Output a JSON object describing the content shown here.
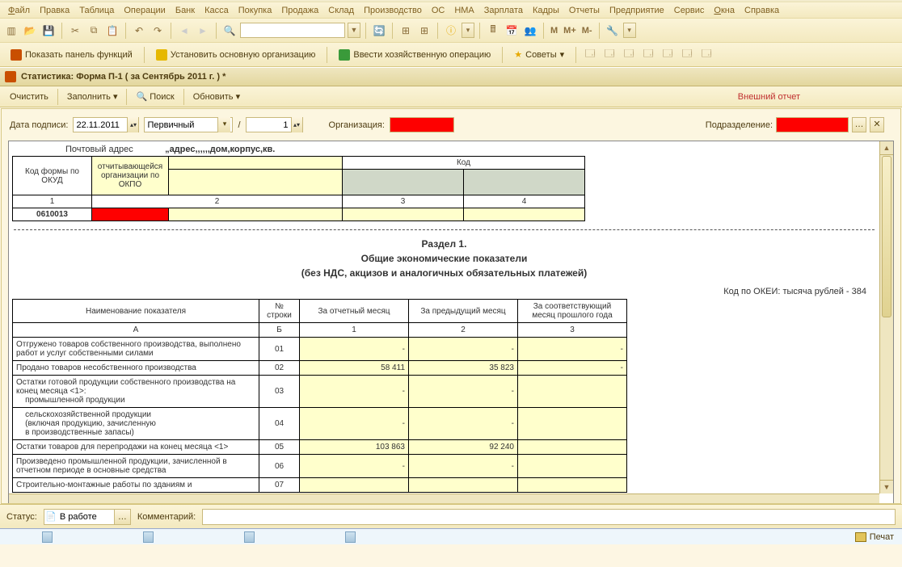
{
  "menu": {
    "file": "Файл",
    "edit": "Правка",
    "table": "Таблица",
    "ops": "Операции",
    "bank": "Банк",
    "kassa": "Касса",
    "buy": "Покупка",
    "sell": "Продажа",
    "sklad": "Склад",
    "proizv": "Производство",
    "os": "ОС",
    "nma": "НМА",
    "zp": "Зарплата",
    "kadry": "Кадры",
    "otchety": "Отчеты",
    "predpr": "Предприятие",
    "service": "Сервис",
    "okna": "Окна",
    "spr": "Справка"
  },
  "toolbar2": {
    "panel": "Показать панель функций",
    "org": "Установить основную организацию",
    "hoz": "Ввести хозяйственную операцию",
    "sov": "Советы"
  },
  "doctitle": "Статистика: Форма П-1 ( за Сентябрь 2011 г. ) *",
  "cmd": {
    "clear": "Очистить",
    "fill": "Заполнить",
    "find": "Поиск",
    "upd": "Обновить",
    "ext": "Внешний отчет"
  },
  "filters": {
    "date_lbl": "Дата подписи:",
    "date_val": "22.11.2011",
    "type_val": "Первичный",
    "num_lbl": "/",
    "num_val": "1",
    "org_lbl": "Организация:",
    "sub_lbl": "Подразделение:"
  },
  "addr": {
    "label": "Почтовый адрес",
    "val": "„адрес,,,,,,дом,корпус,кв."
  },
  "hdrtbl": {
    "kodformy": "Код формы по ОКУД",
    "otch": "отчитывающейся организации по ОКПО",
    "kod": "Код",
    "n1": "1",
    "n2": "2",
    "n3": "3",
    "n4": "4",
    "okud": "0610013"
  },
  "section": {
    "l1": "Раздел 1.",
    "l2": "Общие экономические показатели",
    "l3": "(без НДС, акцизов и аналогичных обязательных платежей)"
  },
  "okei": "Код по ОКЕИ: тысяча рублей - 384",
  "cols": {
    "name": "Наименование показателя",
    "num": "№ строки",
    "c1": "За отчетный месяц",
    "c2": "За предыдущий месяц",
    "c3": "За соответствующий месяц прошлого года",
    "hA": "А",
    "hB": "Б",
    "h1": "1",
    "h2": "2",
    "h3": "3"
  },
  "rows": [
    {
      "name": "Отгружено товаров собственного производства, выполнено работ и услуг собственными силами",
      "num": "01",
      "v1": "-",
      "v2": "-",
      "v3": "-"
    },
    {
      "name": "Продано товаров несобственного производства",
      "num": "02",
      "v1": "58 411",
      "v2": "35 823",
      "v3": "-"
    },
    {
      "name": "Остатки готовой продукции собственного производства на конец месяца <1>:\n    промышленной продукции",
      "num": "03",
      "v1": "-",
      "v2": "-",
      "v3": ""
    },
    {
      "name": "    сельскохозяйственной продукции\n    (включая продукцию, зачисленную\n    в производственные запасы)",
      "num": "04",
      "v1": "-",
      "v2": "-",
      "v3": ""
    },
    {
      "name": "Остатки товаров для перепродажи на конец месяца <1>",
      "num": "05",
      "v1": "103 863",
      "v2": "92 240",
      "v3": ""
    },
    {
      "name": "Произведено промышленной продукции, зачисленной в отчетном периоде в основные средства",
      "num": "06",
      "v1": "-",
      "v2": "-",
      "v3": ""
    },
    {
      "name": "Строительно-монтажные работы по зданиям и",
      "num": "07",
      "v1": "",
      "v2": "",
      "v3": ""
    }
  ],
  "status": {
    "lbl": "Статус:",
    "val": "В работе",
    "comm_lbl": "Комментарий:"
  },
  "pechat": "Печат"
}
